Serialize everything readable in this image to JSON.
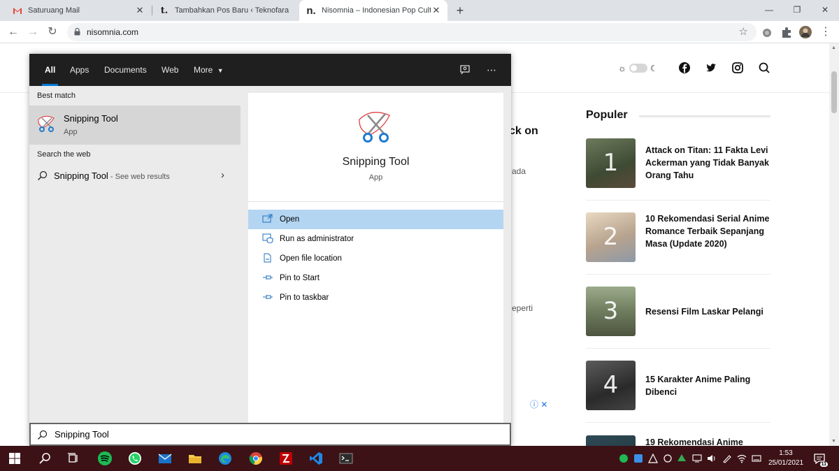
{
  "browser": {
    "tabs": [
      {
        "title": "Saturuang Mail"
      },
      {
        "title": "Tambahkan Pos Baru ‹ Teknofara"
      },
      {
        "title": "Nisomnia – Indonesian Pop Cultu"
      }
    ],
    "url": "nisomnia.com"
  },
  "site": {
    "article_fragments": [
      "ck on",
      "ada",
      "eperti"
    ],
    "populer_title": "Populer",
    "popular": [
      {
        "rank": "1",
        "title": "Attack on Titan: 11 Fakta Levi Ackerman yang Tidak Banyak Orang Tahu",
        "thumb_color": "#4a5a3c"
      },
      {
        "rank": "2",
        "title": "10 Rekomendasi Serial Anime Romance Terbaik Sepanjang Masa (Update 2020)",
        "thumb_color": "#c9b49a"
      },
      {
        "rank": "3",
        "title": "Resensi Film Laskar Pelangi",
        "thumb_color": "#7d8a6a"
      },
      {
        "rank": "4",
        "title": "15 Karakter Anime Paling Dibenci",
        "thumb_color": "#3a3a3a"
      },
      {
        "rank": "",
        "title": "19 Rekomendasi Anime",
        "thumb_color": "#2e4a55"
      }
    ]
  },
  "search_panel": {
    "tabs": [
      "All",
      "Apps",
      "Documents",
      "Web",
      "More"
    ],
    "best_match_label": "Best match",
    "best_match": {
      "name": "Snipping Tool",
      "type": "App"
    },
    "search_web_label": "Search the web",
    "web_result": {
      "query": "Snipping Tool",
      "hint": " - See web results"
    },
    "preview": {
      "name": "Snipping Tool",
      "type": "App"
    },
    "actions": [
      "Open",
      "Run as administrator",
      "Open file location",
      "Pin to Start",
      "Pin to taskbar"
    ],
    "query": "Snipping Tool"
  },
  "taskbar": {
    "time": "1:53",
    "date": "25/01/2021",
    "notification_count": "11"
  }
}
